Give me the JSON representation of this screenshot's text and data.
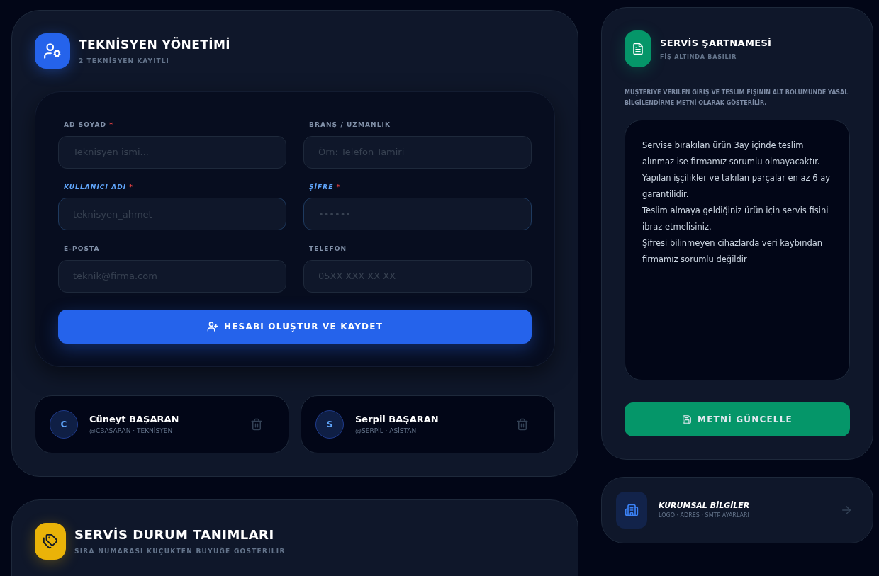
{
  "technicians_panel": {
    "title": "TEKNİSYEN YÖNETİMİ",
    "subtitle": "2 TEKNİSYEN KAYITLI",
    "fields": [
      {
        "label": "AD SOYAD",
        "required": true,
        "highlighted": false,
        "placeholder": "Teknisyen ismi..."
      },
      {
        "label": "BRANŞ / UZMANLIK",
        "required": false,
        "highlighted": false,
        "placeholder": "Örn: Telefon Tamiri"
      },
      {
        "label": "KULLANICI ADI",
        "required": true,
        "highlighted": true,
        "placeholder": "teknisyen_ahmet"
      },
      {
        "label": "ŞİFRE",
        "required": true,
        "highlighted": true,
        "placeholder": "••••••"
      },
      {
        "label": "E-POSTA",
        "required": false,
        "highlighted": false,
        "placeholder": "teknik@firma.com"
      },
      {
        "label": "TELEFON",
        "required": false,
        "highlighted": false,
        "placeholder": "05XX XXX XX XX"
      }
    ],
    "required_mark": "*",
    "submit_button": "HESABI OLUŞTUR VE KAYDET",
    "technicians": [
      {
        "initial": "C",
        "name": "Cüneyt BAŞARAN",
        "meta": "@CBASARAN · TEKNİSYEN"
      },
      {
        "initial": "S",
        "name": "Serpil BAŞARAN",
        "meta": "@SERPİL · ASİSTAN"
      }
    ]
  },
  "status_panel": {
    "title": "SERVİS DURUM TANIMLARI",
    "subtitle": "SIRA NUMARASI KÜÇÜKTEN BÜYÜĞE GÖSTERİLİR"
  },
  "terms_panel": {
    "title": "SERVİS ŞARTNAMESİ",
    "subtitle": "FİŞ ALTINDA BASILIR",
    "description": "MÜŞTERİYE VERİLEN GİRİŞ VE TESLİM FİŞİNİN ALT BÖLÜMÜNDE YASAL BİLGİLENDİRME METNİ OLARAK GÖSTERİLİR.",
    "text": "Servise bırakılan ürün 3ay içinde teslim alınmaz ise firmamız sorumlu olmayacaktır.\nYapılan işçilikler ve takılan parçalar en az 6 ay garantilidir.\nTeslim almaya geldiğiniz ürün için servis fişini ibraz etmelisiniz.\nŞifresi bilinmeyen cihazlarda veri kaybından firmamız sorumlu değildir",
    "button": "METNİ GÜNCELLE"
  },
  "company_link": {
    "title": "KURUMSAL BİLGİLER",
    "subtitle": "LOGO · ADRES · SMTP AYARLARI"
  }
}
